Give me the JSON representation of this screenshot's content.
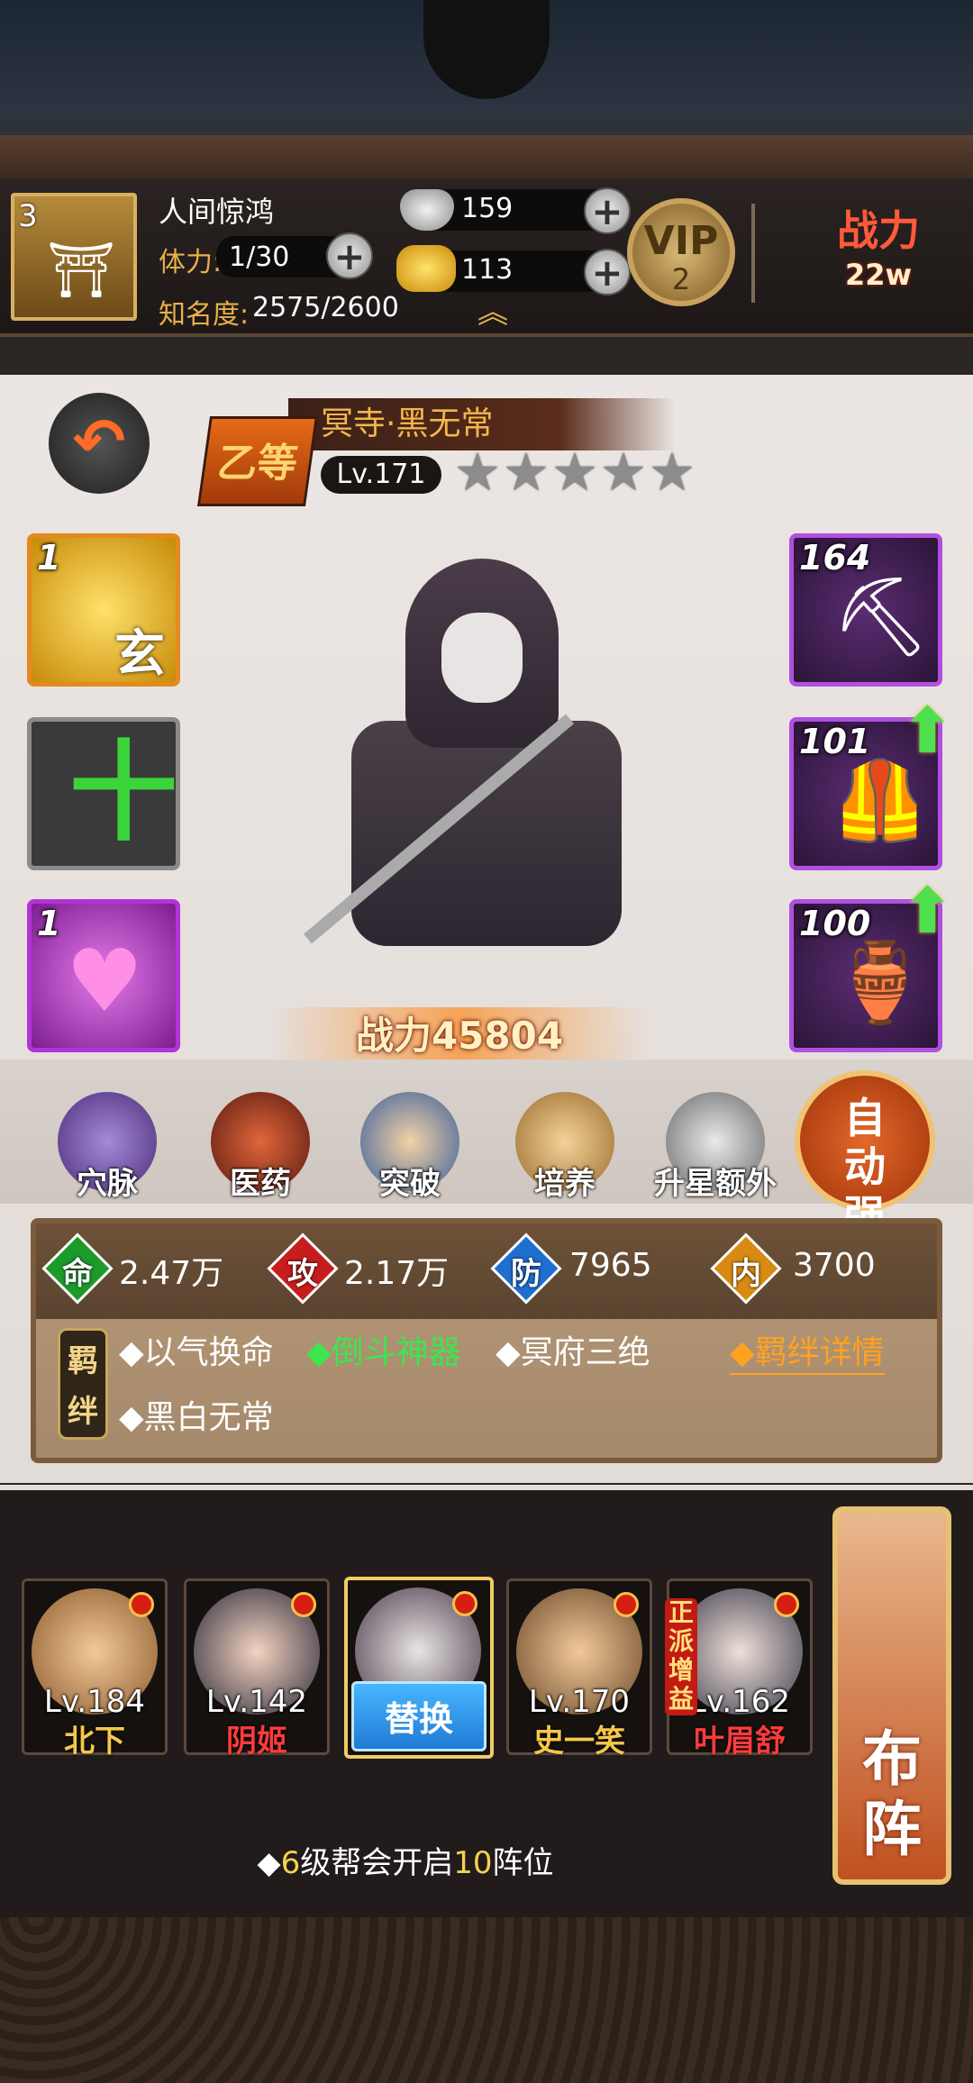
{
  "player": {
    "guild_level": "3",
    "name": "人间惊鸿",
    "stamina_label": "体力:",
    "stamina_value": "1/30",
    "fame_label": "知名度:",
    "fame_value": "2575/2600",
    "silver": "159",
    "gold": "113",
    "vip_label": "VIP",
    "vip_level": "2",
    "power_label": "战力",
    "power_value": "22w"
  },
  "hero": {
    "grade": "乙等",
    "name": "冥寺·黑无常",
    "level": "Lv.171",
    "stars": 5,
    "stars_filled": 0,
    "power_label": "战力",
    "power_value": "45804"
  },
  "skills": [
    {
      "count": "1",
      "glyph": "玄"
    },
    {
      "count": "",
      "glyph": "十"
    },
    {
      "count": "1",
      "glyph": "♥"
    }
  ],
  "equipment": [
    {
      "level": "164",
      "icon": "shovel-icon"
    },
    {
      "level": "101",
      "icon": "armor-icon",
      "upgradable": true
    },
    {
      "level": "100",
      "icon": "teapot-icon",
      "upgradable": true
    }
  ],
  "functions": [
    {
      "label": "穴脉",
      "icon": "meridian-icon"
    },
    {
      "label": "医药",
      "icon": "medicine-icon"
    },
    {
      "label": "突破",
      "icon": "breakthrough-icon"
    },
    {
      "label": "培养",
      "icon": "cultivate-icon"
    },
    {
      "label": "升星额外",
      "icon": "star-up-icon"
    }
  ],
  "auto_enhance": "自动强化",
  "stats": [
    {
      "key": "命",
      "value": "2.47万",
      "color": "#1c9a2c"
    },
    {
      "key": "攻",
      "value": "2.17万",
      "color": "#c81d1d"
    },
    {
      "key": "防",
      "value": "7965",
      "color": "#1e6fd0"
    },
    {
      "key": "内",
      "value": "3700",
      "color": "#d88a12"
    }
  ],
  "bonds": {
    "tag": "羁绊",
    "items": [
      {
        "text": "◆以气换命",
        "active": false
      },
      {
        "text": "◆倒斗神器",
        "active": true
      },
      {
        "text": "◆冥府三绝",
        "active": false
      },
      {
        "text": "◆黑白无常",
        "active": false
      }
    ],
    "detail_link": "◆羁绊详情"
  },
  "lineup": [
    {
      "level": "Lv.184",
      "name": "北下",
      "name_color": "#f5c84a"
    },
    {
      "level": "Lv.142",
      "name": "阴姬",
      "name_color": "#ff3b3b"
    },
    {
      "level": "",
      "name": "",
      "swap": "替换"
    },
    {
      "level": "Lv.170",
      "name": "史一笑",
      "name_color": "#f5c84a"
    },
    {
      "level": "Lv.162",
      "name": "叶眉舒",
      "name_color": "#ff3b3b",
      "badge": "正派增益"
    }
  ],
  "formation_label": "布阵",
  "tip": {
    "prefix": "◆",
    "num1": "6",
    "mid": "级帮会开启",
    "num2": "10",
    "suffix": "阵位"
  }
}
